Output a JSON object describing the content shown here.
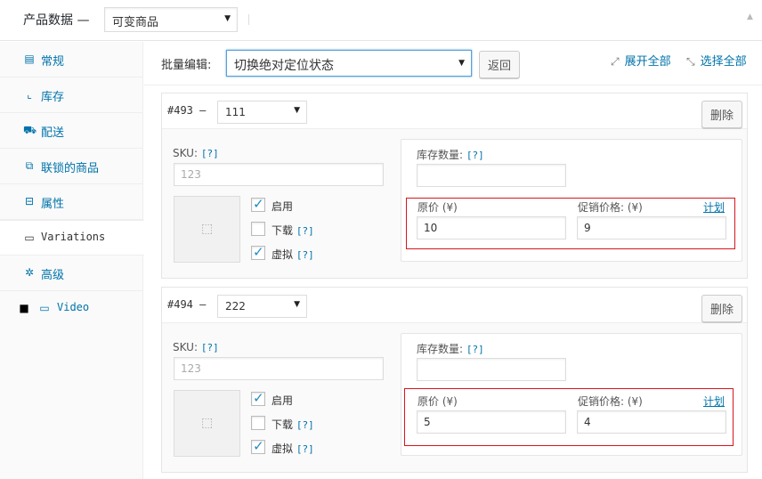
{
  "header": {
    "title": "产品数据 —",
    "product_type": "可变商品"
  },
  "sidebar": {
    "items": [
      {
        "label": "常规",
        "icon": "general-icon"
      },
      {
        "label": "库存",
        "icon": "inventory-icon"
      },
      {
        "label": "配送",
        "icon": "shipping-icon"
      },
      {
        "label": "联锁的商品",
        "icon": "link-icon"
      },
      {
        "label": "属性",
        "icon": "attributes-icon"
      },
      {
        "label": "Variations",
        "icon": "variations-icon"
      },
      {
        "label": "高级",
        "icon": "advanced-icon"
      },
      {
        "label": "Video",
        "icon": "video-icon"
      }
    ]
  },
  "bulk": {
    "label": "批量编辑:",
    "selected": "切换绝对定位状态",
    "back_label": "返回",
    "expand_all": "展开全部",
    "select_all": "选择全部"
  },
  "variations": [
    {
      "id": "#493 —",
      "attribute": "111",
      "delete_label": "删除",
      "sku_label": "SKU:",
      "sku_help": "[?]",
      "sku_placeholder": "123",
      "stock_label": "库存数量:",
      "stock_help": "[?]",
      "enabled_label": "启用",
      "download_label": "下载",
      "download_help": "[?]",
      "virtual_label": "虚拟",
      "virtual_help": "[?]",
      "regular_price_label": "原价 (¥)",
      "regular_price": "10",
      "sale_price_label": "促销价格: (¥)",
      "sale_price": "9",
      "schedule_label": "计划"
    },
    {
      "id": "#494 —",
      "attribute": "222",
      "delete_label": "删除",
      "sku_label": "SKU:",
      "sku_help": "[?]",
      "sku_placeholder": "123",
      "stock_label": "库存数量:",
      "stock_help": "[?]",
      "enabled_label": "启用",
      "download_label": "下载",
      "download_help": "[?]",
      "virtual_label": "虚拟",
      "virtual_help": "[?]",
      "regular_price_label": "原价 (¥)",
      "regular_price": "5",
      "sale_price_label": "促销价格: (¥)",
      "sale_price": "4",
      "schedule_label": "计划"
    }
  ],
  "colors": {
    "link": "#0073aa",
    "highlight_border": "#d6161e"
  }
}
